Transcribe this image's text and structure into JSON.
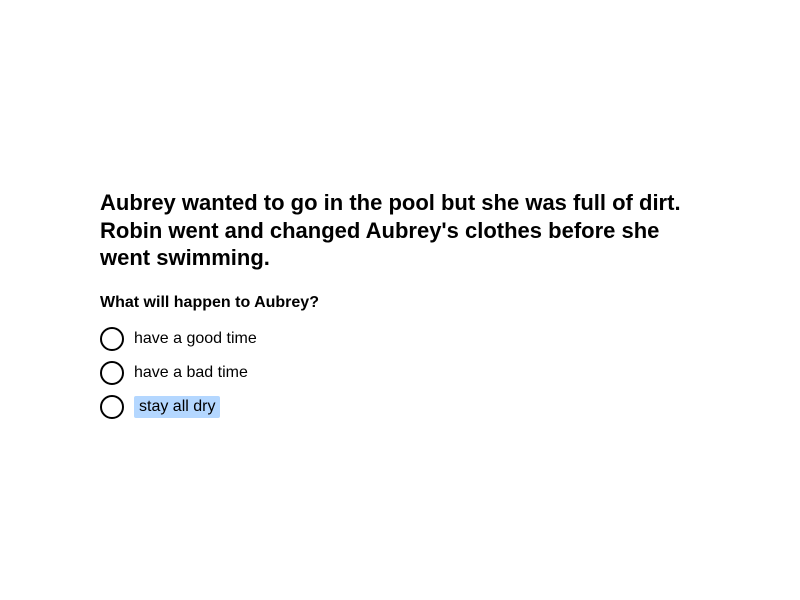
{
  "passage": "Aubrey wanted to go in the pool but she was full of dirt. Robin went and changed Aubrey's clothes before she went swimming.",
  "question": "What will happen to Aubrey?",
  "options": [
    {
      "label": "have a good time"
    },
    {
      "label": "have a bad time"
    },
    {
      "label": "stay all dry",
      "highlighted": true
    }
  ],
  "colors": {
    "text": "#000000",
    "highlight": "#b4d7ff",
    "background": "#ffffff"
  }
}
